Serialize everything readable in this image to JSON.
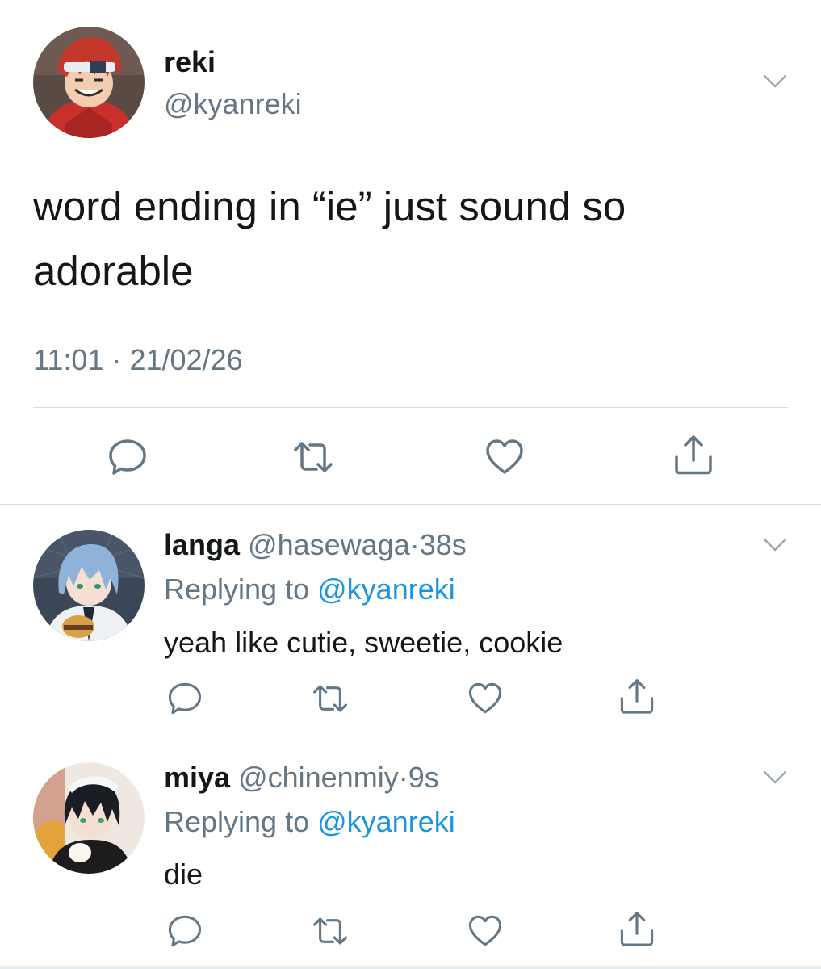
{
  "main_tweet": {
    "name": "reki",
    "handle": "@kyanreki",
    "text": "word ending in “ie” just sound so adorable",
    "time": "11:01",
    "separator": "·",
    "date": "21/02/26",
    "icons": {
      "menu": "chevron-down-icon",
      "reply": "reply-icon",
      "retweet": "retweet-icon",
      "like": "heart-icon",
      "share": "share-icon"
    }
  },
  "replies": [
    {
      "name": "langa",
      "handle": "@hasewaga",
      "separator": "·",
      "time": "38s",
      "replying_label": "Replying to",
      "replying_to": "@kyanreki",
      "text": "yeah like cutie, sweetie, cookie"
    },
    {
      "name": "miya",
      "handle": "@chinenmiy",
      "separator": "·",
      "time": "9s",
      "replying_label": "Replying to",
      "replying_to": "@kyanreki",
      "text": "die"
    }
  ],
  "colors": {
    "text": "#14171a",
    "secondary": "#657786",
    "link": "#1b95e0",
    "icon": "#657786",
    "divider": "#d6dde3"
  }
}
